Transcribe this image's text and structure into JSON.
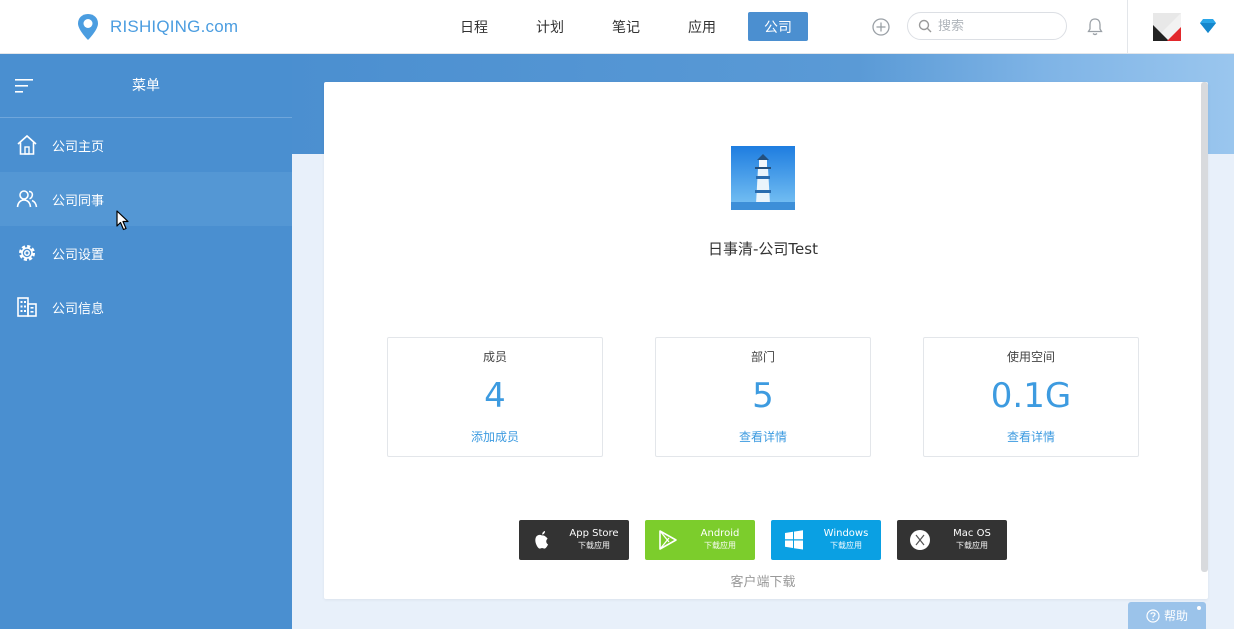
{
  "brand": {
    "name": "RISHIQING.com",
    "color": "#4b9de0"
  },
  "nav": {
    "items": [
      {
        "label": "日程",
        "active": false
      },
      {
        "label": "计划",
        "active": false
      },
      {
        "label": "笔记",
        "active": false
      },
      {
        "label": "应用",
        "active": false
      },
      {
        "label": "公司",
        "active": true
      }
    ]
  },
  "search": {
    "placeholder": "搜索"
  },
  "sidebar": {
    "title": "菜单",
    "items": [
      {
        "label": "公司主页",
        "icon": "home-icon"
      },
      {
        "label": "公司同事",
        "icon": "users-icon"
      },
      {
        "label": "公司设置",
        "icon": "gear-icon"
      },
      {
        "label": "公司信息",
        "icon": "building-icon"
      }
    ]
  },
  "company": {
    "name": "日事清-公司Test"
  },
  "stats": [
    {
      "label": "成员",
      "value": "4",
      "link": "添加成员"
    },
    {
      "label": "部门",
      "value": "5",
      "link": "查看详情"
    },
    {
      "label": "使用空间",
      "value": "0.1G",
      "link": "查看详情"
    }
  ],
  "downloads": {
    "caption": "客户端下载",
    "items": [
      {
        "title": "App Store",
        "sub": "下载应用",
        "icon": "apple-icon",
        "color": "#333333"
      },
      {
        "title": "Android",
        "sub": "下载应用",
        "icon": "play-icon",
        "color": "#7ccd2c"
      },
      {
        "title": "Windows",
        "sub": "下载应用",
        "icon": "windows-icon",
        "color": "#0aa0e3"
      },
      {
        "title": "Mac OS",
        "sub": "下载应用",
        "icon": "macos-icon",
        "color": "#333333"
      }
    ]
  },
  "help": {
    "label": "帮助"
  },
  "colors": {
    "sidebar": "#4a8fd0",
    "accent": "#3d9be0",
    "nav_active": "#4b8fd0"
  }
}
